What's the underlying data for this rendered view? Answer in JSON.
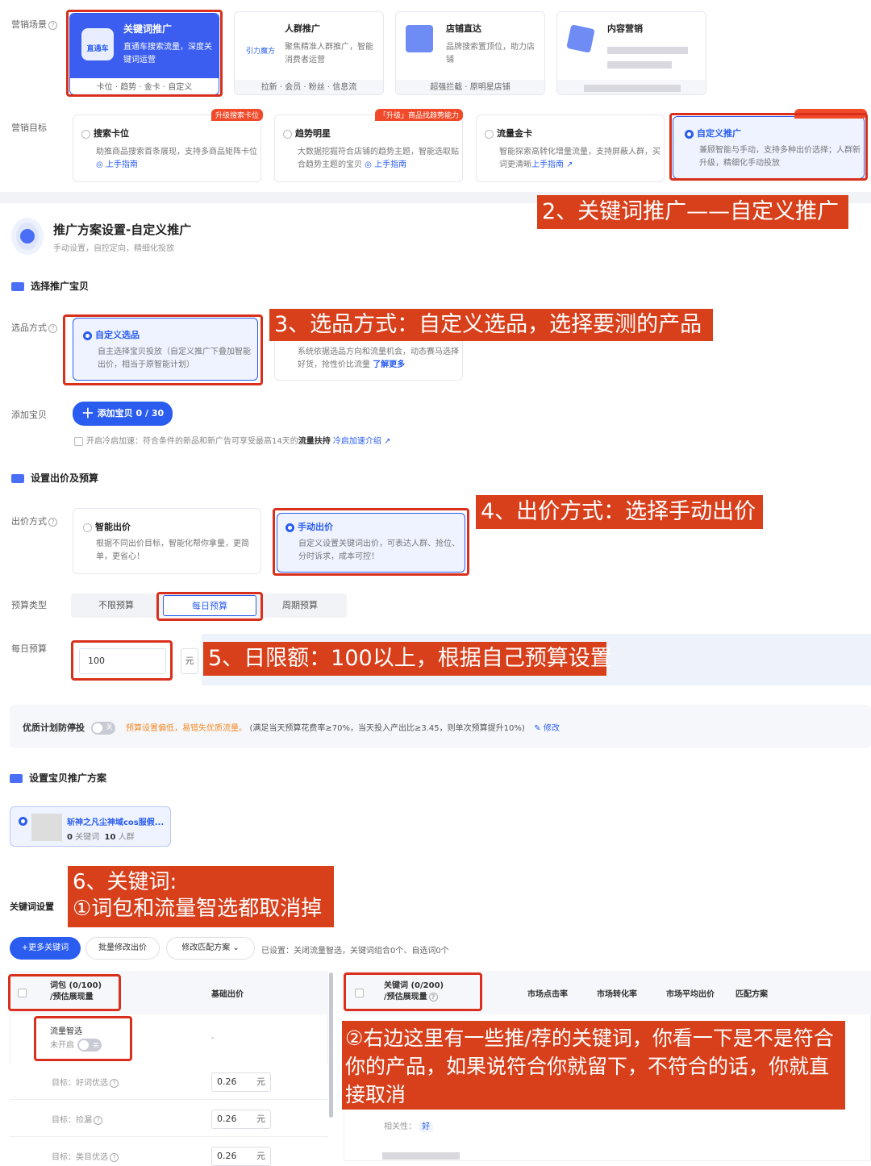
{
  "marketing_scene": {
    "label": "营销场景",
    "cards": [
      {
        "title": "关键词推广",
        "icon": "直通车",
        "desc": "直通车搜索流量，深度关键词运营",
        "tags": "卡位 · 趋势 · 金卡 · 自定义"
      },
      {
        "title": "人群推广",
        "icon": "引力魔方",
        "desc": "聚焦精准人群推广，智能消费者运营",
        "tags": "拉新 · 会员 · 粉丝 · 信息流"
      },
      {
        "title": "店铺直达",
        "desc": "品牌搜索置顶位，助力店铺",
        "tags": "超强拦截 · 原明星店铺"
      },
      {
        "title": "内容营销",
        "desc": "",
        "tags": ""
      }
    ]
  },
  "marketing_goal": {
    "label": "营销目标",
    "cards": [
      {
        "title": "搜索卡位",
        "desc": "助推商品搜索首条展现，支持多商品矩阵卡位",
        "link": "上手指南",
        "badge": "升级搜索卡位"
      },
      {
        "title": "趋势明星",
        "desc": "大数据挖掘符合店铺的趋势主题，智能选取贴合趋势主题的宝贝",
        "link": "上手指南",
        "badge": "「升级」商品找趋势能力"
      },
      {
        "title": "流量金卡",
        "desc": "智能探索高转化增量流量，支持屏蔽人群，买词更清晰",
        "link": "上手指南"
      },
      {
        "title": "自定义推广",
        "desc": "兼顾智能与手动，支持多种出价选择；人群新升级，精细化手动投放"
      }
    ]
  },
  "plan": {
    "title": "推广方案设置-自定义推广",
    "subtitle": "手动设置，自控定向，精细化投放"
  },
  "section_select": "选择推广宝贝",
  "select_method": {
    "label": "选品方式",
    "opt1_title": "自定义选品",
    "opt1_desc": "自主选择宝贝投放（自定义推广下叠加智能出价，相当于原智能计划）",
    "opt2_desc": "系统依据选品方向和流量机会，动态赛马选择好货，抢性价比流量",
    "opt2_link": "了解更多"
  },
  "add_item": {
    "label": "添加宝贝",
    "button": "添加宝贝 0 / 30",
    "cold_start": "开启冷启加速：符合条件的新品和新广告可享受最高14天的",
    "cold_bold": "流量扶持",
    "cold_link": "冷启加速介绍"
  },
  "section_bid": "设置出价及预算",
  "bid_method": {
    "label": "出价方式",
    "opt1_title": "智能出价",
    "opt1_desc": "根据不同出价目标，智能化帮你拿量，更简单，更省心！",
    "opt2_title": "手动出价",
    "opt2_desc": "自定义设置关键词出价，可表达人群、抢位、分时诉求，成本可控！"
  },
  "budget_type": {
    "label": "预算类型",
    "tabs": [
      "不限预算",
      "每日预算",
      "周期预算"
    ]
  },
  "daily_budget": {
    "label": "每日预算",
    "value": "100",
    "unit": "元"
  },
  "quality": {
    "label": "优质计划防停投",
    "toggle": "关",
    "warn": "预算设置偏低，易错失优质流量。",
    "desc": "(满足当天预算花费率≥70%，当天投入产出比≥3.45，则单次预算提升10%)",
    "edit": "修改"
  },
  "section_scheme": "设置宝贝推广方案",
  "product": {
    "name": "斩神之凡尘神域cos服假...",
    "kw_count": "0",
    "kw_label": "关键词",
    "people": "10",
    "people_label": "人群"
  },
  "kw_settings": {
    "label": "关键词设置",
    "more_btn": "+更多关键词",
    "batch_btn": "批量修改出价",
    "match_btn": "修改匹配方案",
    "status": "已设置：关闭流量智选，关键词组合0个、自选词0个"
  },
  "left_table": {
    "h1a": "词包 (0/100)",
    "h1b": "/预估展现量",
    "h2": "基础出价",
    "smart": "流量智选",
    "smart_status": "未开启",
    "smart_toggle": "关",
    "smart_val": "-",
    "rows": [
      {
        "label": "目标：好词优选",
        "val": "0.26",
        "unit": "元"
      },
      {
        "label": "目标：捡漏",
        "val": "0.26",
        "unit": "元"
      },
      {
        "label": "目标：类目优选",
        "val": "0.26",
        "unit": "元"
      }
    ]
  },
  "right_table": {
    "h1a": "关键词 (0/200)",
    "h1b": "/预估展现量",
    "cols": [
      "市场点击率",
      "市场转化率",
      "市场平均出价",
      "匹配方案"
    ],
    "rel": "相关性：",
    "rel_val": "好"
  },
  "annotations": {
    "a2": "2、关键词推广——自定义推广",
    "a3": "3、选品方式：自定义选品，选择要测的产品",
    "a4": "4、出价方式：选择手动出价",
    "a5": "5、日限额：100以上，根据自己预算设置",
    "a6_1": "6、关键词:",
    "a6_2": "①词包和流量智选都取消掉",
    "a7": "②右边这里有一些推/荐的关键词，你看一下是不是符合你的产品，如果说符合你就留下，不符合的话，你就直接取消"
  },
  "colors": {
    "primary": "#2a5cf0",
    "annotation": "#d8401c",
    "highlight": "#d8301c"
  }
}
